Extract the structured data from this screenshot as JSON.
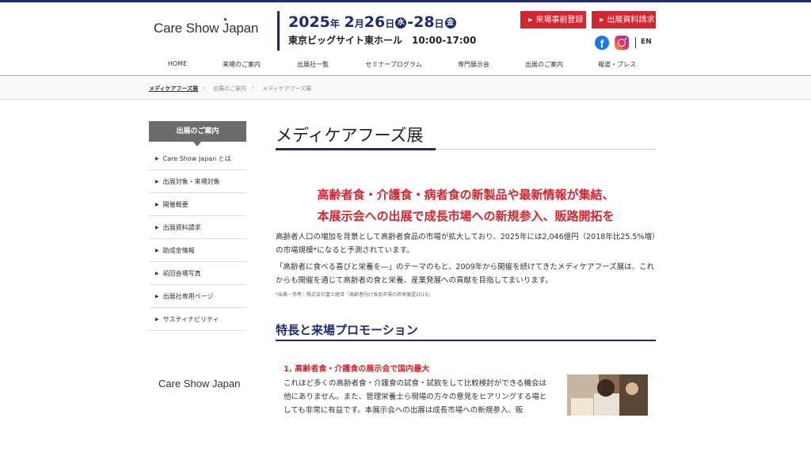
{
  "header": {
    "logo_pre": "Care Show ",
    "logo_j": "J",
    "logo_post": "apan",
    "date": {
      "year": "2025",
      "year_unit": "年",
      "month": "2",
      "month_unit": "月",
      "start_day": "26",
      "start_unit": "日",
      "start_weekday": "水",
      "dash": "-",
      "end_day": "28",
      "end_unit": "日",
      "end_weekday": "金"
    },
    "venue": "東京ビッグサイト東ホール　10:00-17:00",
    "buttons": {
      "register": "来場事前登録",
      "request": "出展資料請求"
    },
    "facebook_glyph": "f",
    "lang": "EN"
  },
  "nav": [
    "HOME",
    "来場のご案内",
    "出展社一覧",
    "セミナープログラム",
    "専門展示会",
    "出展のご案内",
    "報道・プレス"
  ],
  "breadcrumb": [
    "メディケアフーズ展",
    "出展のご案内",
    "メディケアフーズ展"
  ],
  "breadcrumb_sep": "›",
  "sidebar": {
    "heading": "出展のご案内",
    "items": [
      "Care Show Japan とは",
      "出展対象・来場対象",
      "開催概要",
      "出展資料請求",
      "助成金情報",
      "前回会場写真",
      "出展社専用ページ",
      "サスティナビリティ"
    ],
    "logo_pre": "Care Show ",
    "logo_j": "J",
    "logo_post": "apan"
  },
  "main": {
    "title": "メディケアフーズ展",
    "lead_1": "高齢者食・介護食・病者食の新製品や最新情報が集結、",
    "lead_2": "本展示会への出展で成長市場への新規参入、販路開拓を",
    "para_1": "高齢者人口の増加を背景として高齢者食品の市場が拡大しており、2025年には2,046億円（2018年比25.5%増）の市場規模*になると予測されています。",
    "para_2": "「高齢者に食べる喜びと栄養を―」のテーマのもと、2009年から開催を続けてきたメディケアフーズ展は、これからも開催を通じて高齢者の食と栄養、産業発展への貢献を目指してまいります。",
    "note": "*出典・参考：株式会社富士経済「高齢者向け食品市場の将来展望2019」",
    "section_title": "特長と来場プロモーション",
    "feature_1_title": "1. 高齢者食・介護食の展示会で国内最大",
    "feature_1_text": "これほど多くの高齢者食・介護食の試食・試飲をして比較検討ができる機会は他にありません。また、管理栄養士ら現場の方々の意見をヒアリングする場としても非常に有益です。本展示会への出展は成長市場への新規参入、販"
  },
  "colors": {
    "navy": "#1d2d6b",
    "red": "#d4262f"
  },
  "icons": {
    "facebook": "facebook-icon",
    "instagram": "instagram-icon"
  }
}
